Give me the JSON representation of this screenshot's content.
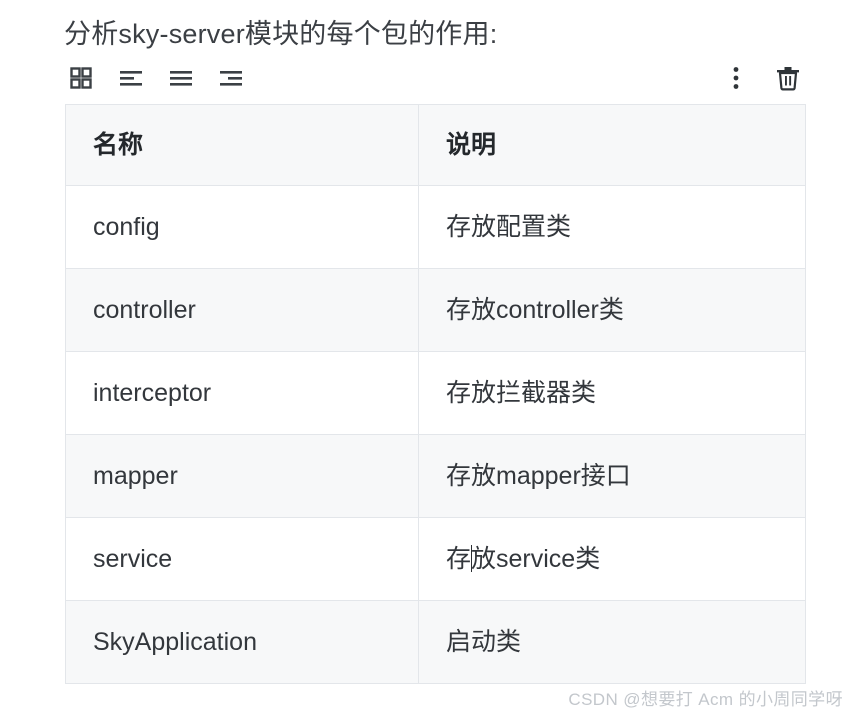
{
  "document": {
    "title": "分析sky-server模块的每个包的作用:"
  },
  "toolbar": {
    "left_items": [
      {
        "name": "grid-icon",
        "label": "网格"
      },
      {
        "name": "align-left-icon",
        "label": "左对齐"
      },
      {
        "name": "align-justify-icon",
        "label": "两端对齐"
      },
      {
        "name": "align-right-icon",
        "label": "右对齐"
      }
    ],
    "right_items": [
      {
        "name": "more-vertical-icon",
        "label": "更多"
      },
      {
        "name": "trash-icon",
        "label": "删除"
      }
    ]
  },
  "table": {
    "columns": [
      "名称",
      "说明"
    ],
    "rows": [
      {
        "name": "config",
        "desc": "存放配置类"
      },
      {
        "name": "controller",
        "desc": "存放controller类"
      },
      {
        "name": "interceptor",
        "desc": "存放拦截器类"
      },
      {
        "name": "mapper",
        "desc": "存放mapper接口"
      },
      {
        "name": "service",
        "desc_before_caret": "存",
        "desc_after_caret": "放service类"
      },
      {
        "name": "SkyApplication",
        "desc": "启动类"
      }
    ]
  },
  "watermark": {
    "text": "CSDN @想要打 Acm 的小周同学呀"
  },
  "colors": {
    "text": "#33373c",
    "header_bg": "#f7f8f9",
    "row_alt_bg": "#f7f8f9",
    "border": "#e3e6ea",
    "icon": "#3b4045",
    "watermark": "#c3c7cc"
  }
}
